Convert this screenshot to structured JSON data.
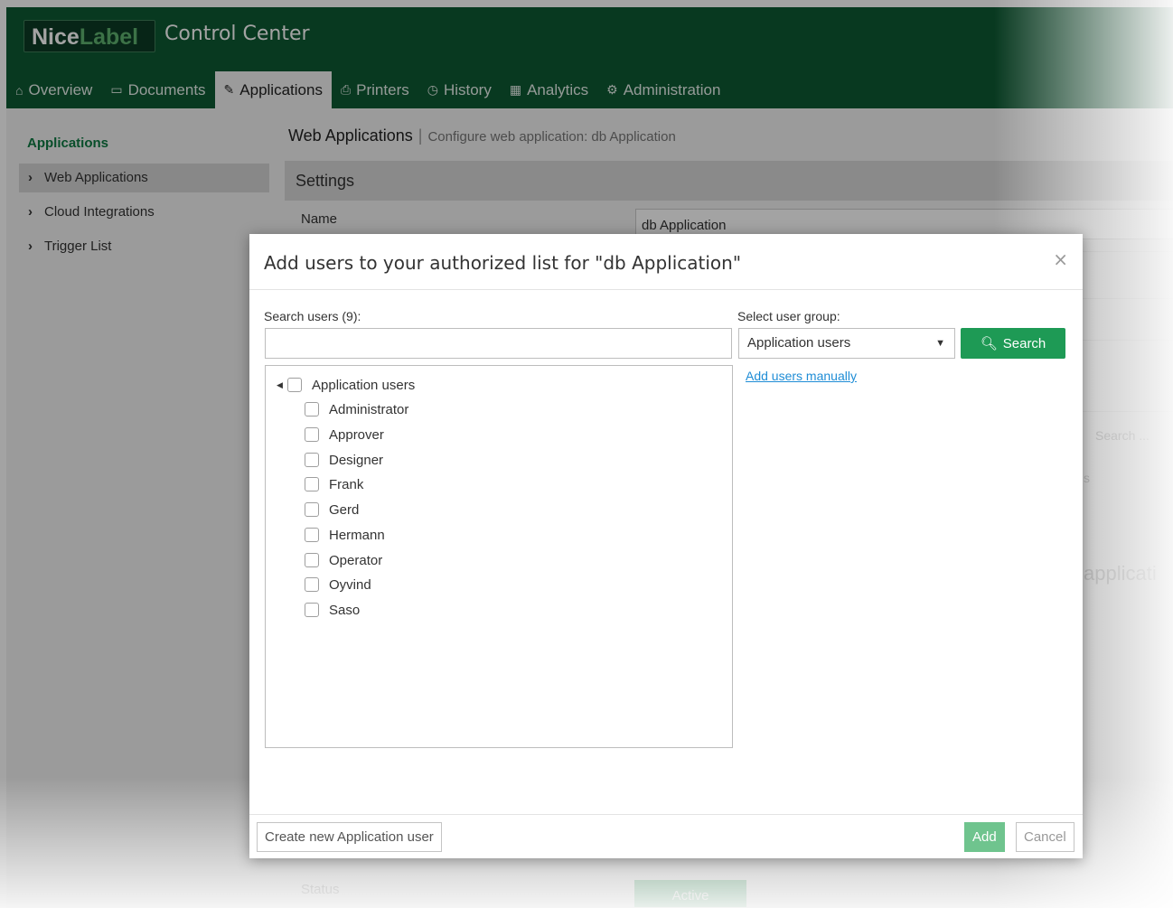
{
  "header": {
    "logo_part1": "Nice",
    "logo_part2": "Label",
    "title": "Control Center"
  },
  "nav": [
    {
      "label": "Overview",
      "icon": "home-icon"
    },
    {
      "label": "Documents",
      "icon": "drive-icon"
    },
    {
      "label": "Applications",
      "icon": "edit-icon",
      "active": true
    },
    {
      "label": "Printers",
      "icon": "printer-icon"
    },
    {
      "label": "History",
      "icon": "clock-icon"
    },
    {
      "label": "Analytics",
      "icon": "chart-icon"
    },
    {
      "label": "Administration",
      "icon": "gears-icon"
    }
  ],
  "sidebar": {
    "title": "Applications",
    "items": [
      "Web Applications",
      "Cloud Integrations",
      "Trigger List"
    ]
  },
  "breadcrumb": {
    "main": "Web Applications",
    "sub": "Configure web application: db Application"
  },
  "settings": {
    "title": "Settings",
    "name_label": "Name",
    "name_value": "db Application",
    "search_placeholder": "Search ...",
    "fragment_s": "s",
    "fragment_applica": "applicati",
    "status_label": "Status",
    "status_value": "Active"
  },
  "modal": {
    "title": "Add users to your authorized list for \"db Application\"",
    "close": "×",
    "search_label": "Search users (9):",
    "search_value": "",
    "group_label": "Select user group:",
    "group_selected": "Application users",
    "search_button": "Search",
    "add_manually": "Add users manually",
    "tree_root": "Application users",
    "users": [
      "Administrator",
      "Approver",
      "Designer",
      "Frank",
      "Gerd",
      "Hermann",
      "Operator",
      "Oyvind",
      "Saso"
    ],
    "create_button": "Create new Application user",
    "add_button": "Add",
    "cancel_button": "Cancel"
  },
  "colors": {
    "header": "#0e5a33",
    "accent_green": "#1e9a55",
    "link": "#1f8dd6"
  }
}
